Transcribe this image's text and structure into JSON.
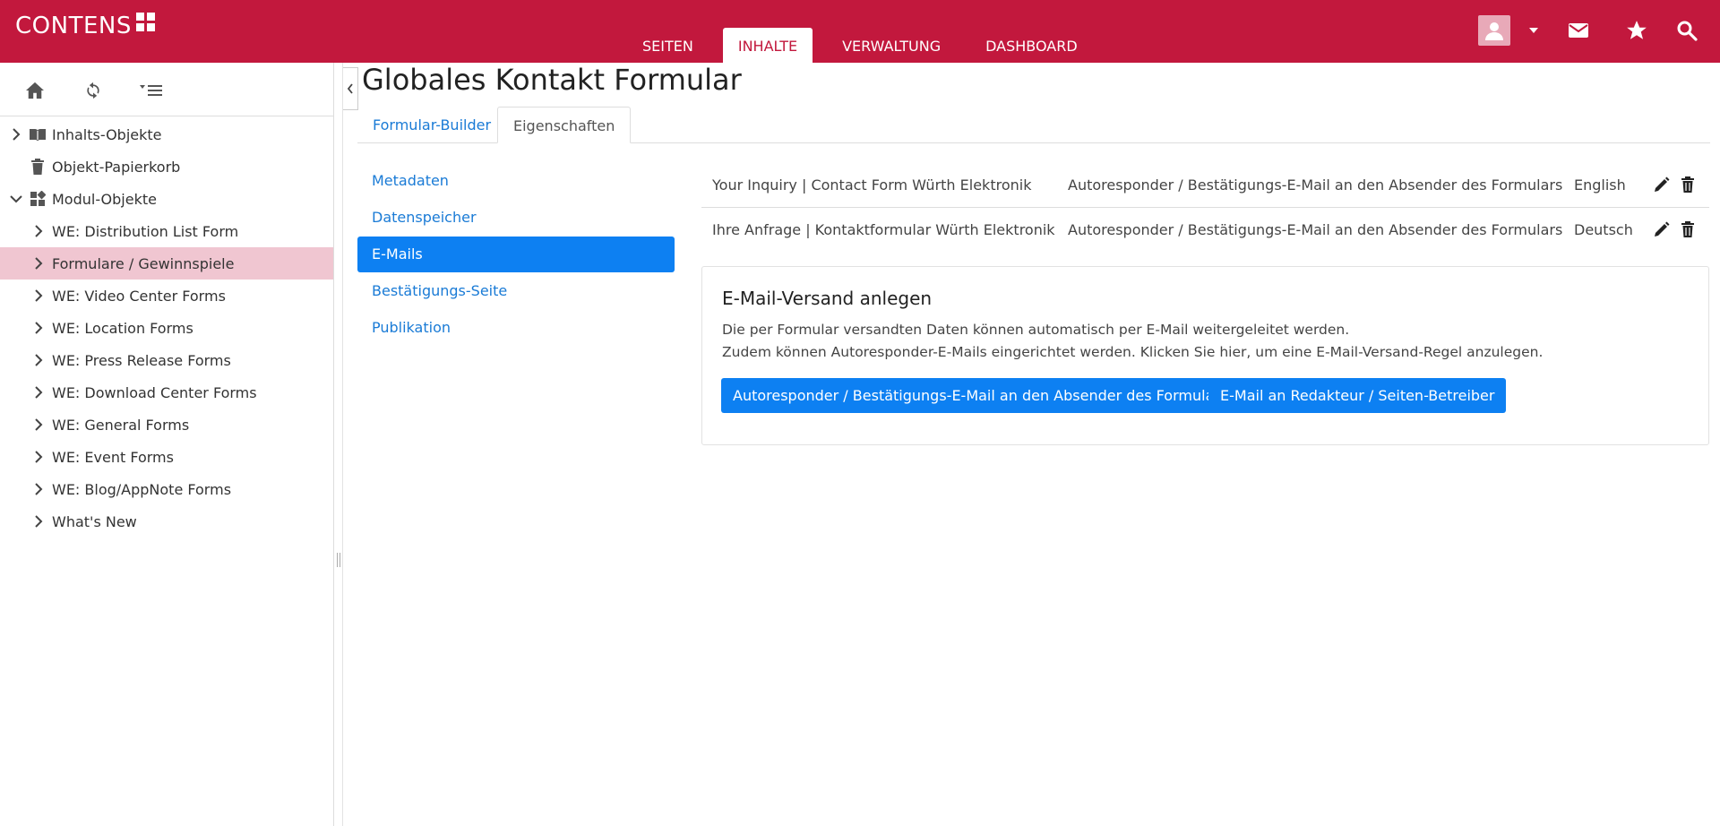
{
  "app": {
    "logo_text": "CONTENS"
  },
  "mainnav": {
    "items": [
      {
        "label": "SEITEN"
      },
      {
        "label": "INHALTE"
      },
      {
        "label": "VERWALTUNG"
      },
      {
        "label": "DASHBOARD"
      }
    ],
    "active": "INHALTE"
  },
  "topbar_icons": [
    "user-avatar-icon",
    "caret-down-icon",
    "mail-icon",
    "star-icon",
    "search-icon"
  ],
  "sidebar": {
    "toolbar_icons": [
      "home-icon",
      "refresh-icon",
      "sort-list-icon"
    ],
    "tree": [
      {
        "label": "Inhalts-Objekte"
      },
      {
        "label": "Objekt-Papierkorb"
      },
      {
        "label": "Modul-Objekte"
      },
      {
        "label": "WE: Distribution List Form"
      },
      {
        "label": "Formulare / Gewinnspiele"
      },
      {
        "label": "WE: Video Center Forms"
      },
      {
        "label": "WE: Location Forms"
      },
      {
        "label": "WE: Press Release Forms"
      },
      {
        "label": "WE: Download Center Forms"
      },
      {
        "label": "WE: General Forms"
      },
      {
        "label": "WE: Event Forms"
      },
      {
        "label": "WE: Blog/AppNote Forms"
      },
      {
        "label": "What's New"
      }
    ]
  },
  "main": {
    "title": "Globales Kontakt Formular",
    "tabs": [
      {
        "label": "Formular-Builder"
      },
      {
        "label": "Eigenschaften"
      }
    ],
    "subnav": [
      {
        "label": "Metadaten"
      },
      {
        "label": "Datenspeicher"
      },
      {
        "label": "E-Mails"
      },
      {
        "label": "Bestätigungs-Seite"
      },
      {
        "label": "Publikation"
      }
    ],
    "emails": [
      {
        "subject": "Your Inquiry | Contact Form Würth Elektronik",
        "type": "Autoresponder / Bestätigungs-E-Mail an den Absender des Formulars",
        "language": "English"
      },
      {
        "subject": "Ihre Anfrage | Kontaktformular Würth Elektronik",
        "type": "Autoresponder / Bestätigungs-E-Mail an den Absender des Formulars",
        "language": "Deutsch"
      }
    ],
    "card": {
      "title": "E-Mail-Versand anlegen",
      "line1": "Die per Formular versandten Daten können automatisch per E-Mail weitergeleitet werden.",
      "line2": "Zudem können Autoresponder-E-Mails eingerichtet werden. Klicken Sie hier, um eine E-Mail-Versand-Regel anzulegen.",
      "button1": "Autoresponder / Bestätigungs-E-Mail an den Absender des Formulars",
      "button2": "E-Mail an Redakteur / Seiten-Betreiber"
    }
  },
  "colors": {
    "brand": "#c2183d",
    "accent": "#0d80f2",
    "link": "#1a7bd6",
    "selected_row": "#f0c6d1"
  }
}
